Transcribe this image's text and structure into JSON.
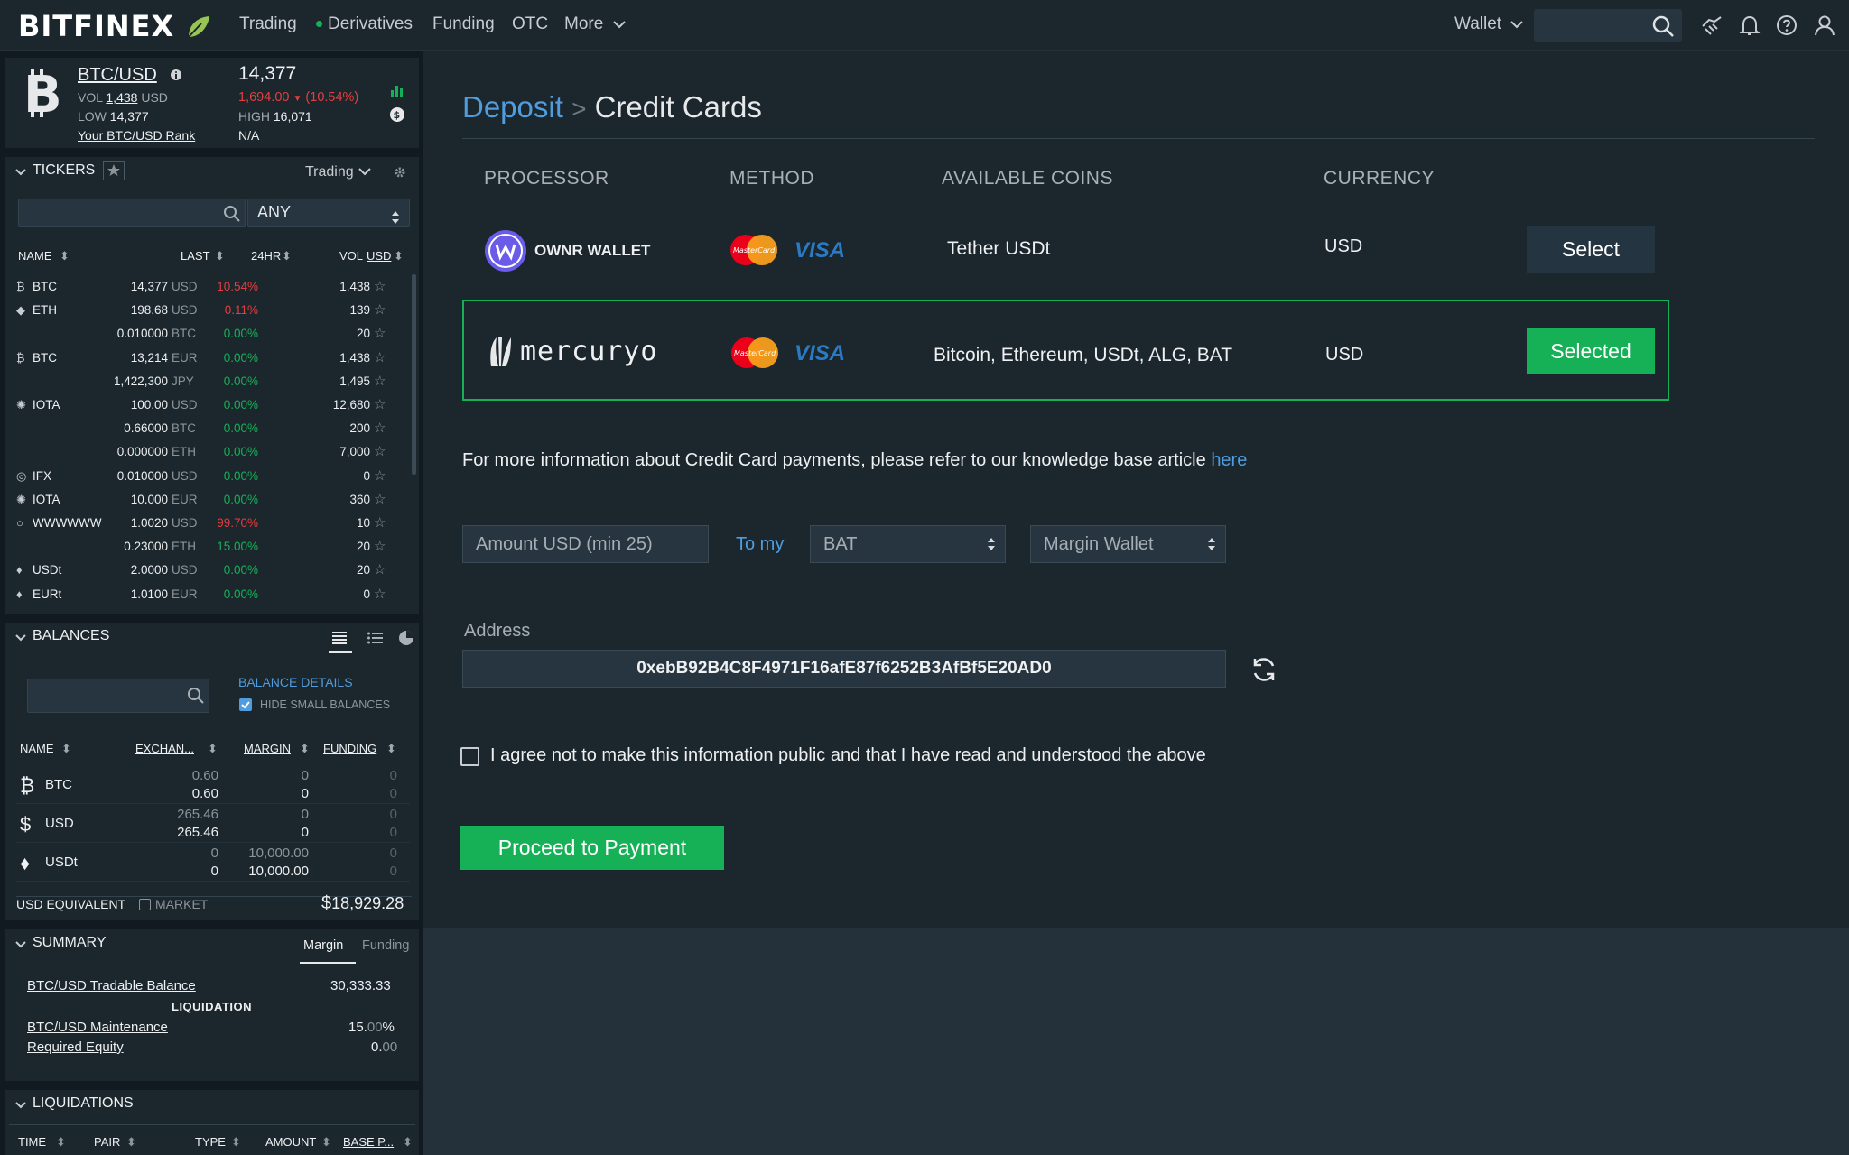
{
  "brand": {
    "logo": "BITFINEX"
  },
  "nav": {
    "trading": "Trading",
    "derivatives": "Derivatives",
    "funding": "Funding",
    "otc": "OTC",
    "more": "More",
    "wallet": "Wallet"
  },
  "ticker_head": {
    "pair": "BTC/USD",
    "last": "14,377",
    "vol_label": "VOL",
    "vol_value": "1,438",
    "vol_unit": "USD",
    "change": "1,694.00",
    "change_pct": "(10.54%)",
    "low_label": "LOW",
    "low": "14,377",
    "high_label": "HIGH",
    "high": "16,071",
    "rank_label": "Your BTC/USD Rank",
    "rank": "N/A"
  },
  "tickers": {
    "title": "TICKERS",
    "mode": "Trading",
    "filter": "ANY",
    "cols": {
      "name": "NAME",
      "last": "LAST",
      "change": "24HR",
      "vol": "VOL",
      "vol_unit": "USD"
    },
    "rows": [
      {
        "sym": "BTC",
        "last": "14,377",
        "unit": "USD",
        "chg": "10.54%",
        "chg_color": "#e53e3e",
        "vol": "1,438",
        "icon": "bitcoin-icon"
      },
      {
        "sym": "ETH",
        "last": "198.68",
        "unit": "USD",
        "chg": "0.11%",
        "chg_color": "#e53e3e",
        "vol": "139",
        "icon": "ethereum-icon"
      },
      {
        "sym": "",
        "last": "0.010000",
        "unit": "BTC",
        "chg": "0.00%",
        "chg_color": "#16b157",
        "vol": "20",
        "icon": ""
      },
      {
        "sym": "BTC",
        "last": "13,214",
        "unit": "EUR",
        "chg": "0.00%",
        "chg_color": "#16b157",
        "vol": "1,438",
        "icon": "bitcoin-icon"
      },
      {
        "sym": "",
        "last": "1,422,300",
        "unit": "JPY",
        "chg": "0.00%",
        "chg_color": "#16b157",
        "vol": "1,495",
        "icon": ""
      },
      {
        "sym": "IOTA",
        "last": "100.00",
        "unit": "USD",
        "chg": "0.00%",
        "chg_color": "#16b157",
        "vol": "12,680",
        "icon": "iota-icon"
      },
      {
        "sym": "",
        "last": "0.66000",
        "unit": "BTC",
        "chg": "0.00%",
        "chg_color": "#16b157",
        "vol": "200",
        "icon": ""
      },
      {
        "sym": "",
        "last": "0.000000",
        "unit": "ETH",
        "chg": "0.00%",
        "chg_color": "#16b157",
        "vol": "7,000",
        "icon": ""
      },
      {
        "sym": "IFX",
        "last": "0.010000",
        "unit": "USD",
        "chg": "0.00%",
        "chg_color": "#16b157",
        "vol": "0",
        "icon": "ifx-icon"
      },
      {
        "sym": "IOTA",
        "last": "10.000",
        "unit": "EUR",
        "chg": "0.00%",
        "chg_color": "#16b157",
        "vol": "360",
        "icon": "iota-icon"
      },
      {
        "sym": "WWWWWW",
        "last": "1.0020",
        "unit": "USD",
        "chg": "99.70%",
        "chg_color": "#e53e3e",
        "vol": "10",
        "icon": "circle-icon"
      },
      {
        "sym": "",
        "last": "0.23000",
        "unit": "ETH",
        "chg": "15.00%",
        "chg_color": "#16b157",
        "vol": "20",
        "icon": ""
      },
      {
        "sym": "USDt",
        "last": "2.0000",
        "unit": "USD",
        "chg": "0.00%",
        "chg_color": "#16b157",
        "vol": "20",
        "icon": "tether-icon"
      },
      {
        "sym": "EURt",
        "last": "1.0100",
        "unit": "EUR",
        "chg": "0.00%",
        "chg_color": "#16b157",
        "vol": "0",
        "icon": "tether-icon"
      }
    ]
  },
  "balances": {
    "title": "BALANCES",
    "details": "BALANCE DETAILS",
    "hide_small": "HIDE SMALL BALANCES",
    "cols": {
      "name": "NAME",
      "exchange": "EXCHAN...",
      "margin": "MARGIN",
      "funding": "FUNDING"
    },
    "rows": [
      {
        "sym": "BTC",
        "ex1": "0.60",
        "ex2": "0.60",
        "m1": "0",
        "m2": "0",
        "f1": "0",
        "f2": "0"
      },
      {
        "sym": "USD",
        "ex1": "265.46",
        "ex2": "265.46",
        "m1": "0",
        "m2": "0",
        "f1": "0",
        "f2": "0"
      },
      {
        "sym": "USDt",
        "ex1": "0",
        "ex2": "0",
        "m1": "10,000.00",
        "m2": "10,000.00",
        "f1": "0",
        "f2": "0"
      }
    ],
    "equiv_unit": "USD",
    "equiv_label": "EQUIVALENT",
    "market": "MARKET",
    "currency_sign": "$",
    "total": "18,929.28"
  },
  "summary": {
    "title": "SUMMARY",
    "tab_margin": "Margin",
    "tab_funding": "Funding",
    "tradable_label": "BTC/USD Tradable Balance",
    "tradable": "30,333.33",
    "liquidation": "LIQUIDATION",
    "maint_label": "BTC/USD Maintenance",
    "maint_main": "15.",
    "maint_dim": "00",
    "maint_pct": "%",
    "req_label": "Required Equity",
    "req_main": "0.",
    "req_dim": "00"
  },
  "liquidations": {
    "title": "LIQUIDATIONS",
    "cols": [
      "TIME",
      "PAIR",
      "TYPE",
      "AMOUNT",
      "BASE P..."
    ]
  },
  "deposit": {
    "crumb": "Deposit",
    "sep": ">",
    "title": "Credit Cards",
    "headers": {
      "processor": "PROCESSOR",
      "method": "METHOD",
      "coins": "AVAILABLE COINS",
      "currency": "CURRENCY"
    },
    "processors": [
      {
        "name": "OWNR WALLET",
        "coins": "Tether USDt",
        "currency": "USD",
        "button": "Select"
      },
      {
        "name": "mercuryo",
        "coins": "Bitcoin, Ethereum, USDt, ALG, BAT",
        "currency": "USD",
        "button": "Selected"
      }
    ],
    "mastercard": "MasterCard",
    "visa": "VISA",
    "info": "For more information about Credit Card payments, please refer to our knowledge base article",
    "info_link": "here",
    "amount_placeholder": "Amount USD (min 25)",
    "to_my": "To my",
    "coin": "BAT",
    "wallet": "Margin Wallet",
    "address_label": "Address",
    "address": "0xebB92B4C8F4971F16afE87f6252B3AfBf5E20AD0",
    "agree": "I agree not to make this information public and that I have read and understood the above",
    "proceed": "Proceed to Payment",
    "colors": {
      "accent": "#16b157",
      "link": "#4f9dde"
    }
  }
}
